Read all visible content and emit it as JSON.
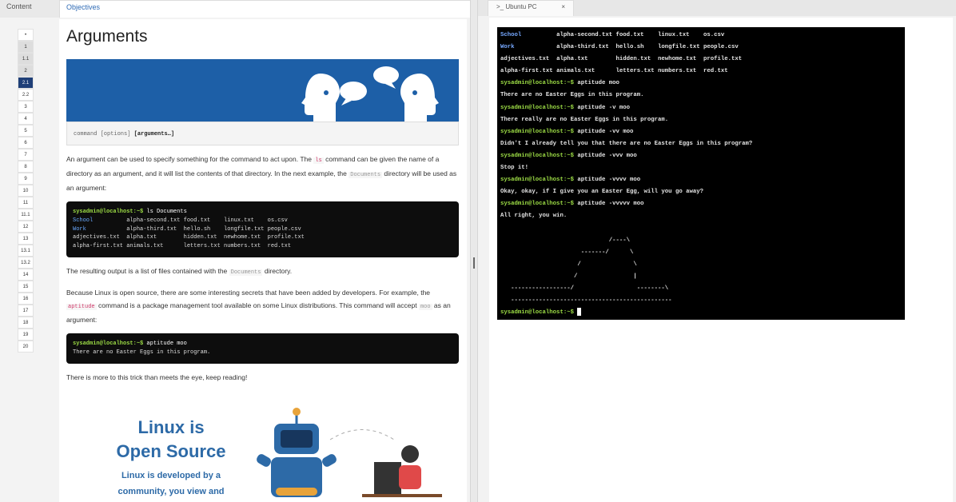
{
  "left_tabs": {
    "content": "Content",
    "objectives": "Objectives"
  },
  "nav": [
    "•",
    "1",
    "1.1",
    "2",
    "2.1",
    "2.2",
    "3",
    "4",
    "5",
    "6",
    "7",
    "8",
    "9",
    "10",
    "11",
    "11.1",
    "12",
    "13",
    "13.1",
    "13.2",
    "14",
    "15",
    "16",
    "17",
    "18",
    "19",
    "20"
  ],
  "doc": {
    "title": "Arguments",
    "syntax_prefix": "command [options] ",
    "syntax_bold": "[arguments…]",
    "p1a": "An argument can be used to specify something for the command to act upon. The ",
    "p1_ls": "ls",
    "p1b": " command can be given the name of a directory as an argument, and it will list the contents of that directory. In the next example, the ",
    "p1_doc": "Documents",
    "p1c": " directory will be used as an argument:",
    "code1_prompt": "sysadmin@localhost:~$",
    "code1_cmd": " ls Documents",
    "code1_rows": [
      {
        "a": "School",
        "b": "alpha-second.txt",
        "c": "food.txt",
        "d": "linux.txt",
        "e": "os.csv",
        "blue": true
      },
      {
        "a": "Work",
        "b": "alpha-third.txt",
        "c": "hello.sh",
        "d": "longfile.txt",
        "e": "people.csv",
        "blue": true
      },
      {
        "a": "adjectives.txt",
        "b": "alpha.txt",
        "c": "hidden.txt",
        "d": "newhome.txt",
        "e": "profile.txt",
        "blue": false
      },
      {
        "a": "alpha-first.txt",
        "b": "animals.txt",
        "c": "letters.txt",
        "d": "numbers.txt",
        "e": "red.txt",
        "blue": false
      }
    ],
    "p2a": "The resulting output is a list of files contained with the ",
    "p2_doc": "Documents",
    "p2b": " directory.",
    "p3a": "Because Linux is open source, there are some interesting secrets that have been added by developers. For example, the ",
    "p3_apt": "aptitude",
    "p3b": " command is a package management tool available on some Linux distributions. This command will accept ",
    "p3_moo": "moo",
    "p3c": " as an argument:",
    "code2_prompt": "sysadmin@localhost:~$",
    "code2_cmd": " aptitude moo",
    "code2_out": "There are no Easter Eggs in this program.",
    "p4": "There is more to this trick than meets the eye, keep reading!",
    "promo_l1": "Linux is",
    "promo_l2": "Open Source",
    "promo_l3": "Linux is developed by a",
    "promo_l4": "community, you view and"
  },
  "right_tab": {
    "title": "Ubuntu PC",
    "close": "×",
    "icon": ">_"
  },
  "terminal": {
    "ls_rows": [
      [
        "School",
        "alpha-second.txt",
        "food.txt",
        "linux.txt",
        "os.csv"
      ],
      [
        "Work",
        "alpha-third.txt",
        "hello.sh",
        "longfile.txt",
        "people.csv"
      ],
      [
        "adjectives.txt",
        "alpha.txt",
        "hidden.txt",
        "newhome.txt",
        "profile.txt"
      ],
      [
        "alpha-first.txt",
        "animals.txt",
        "letters.txt",
        "numbers.txt",
        "red.txt"
      ]
    ],
    "prompt": "sysadmin@localhost:~$",
    "session": [
      {
        "cmd": " aptitude moo",
        "out": "There are no Easter Eggs in this program."
      },
      {
        "cmd": " aptitude -v moo",
        "out": "There really are no Easter Eggs in this program."
      },
      {
        "cmd": " aptitude -vv moo",
        "out": "Didn't I already tell you that there are no Easter Eggs in this program?"
      },
      {
        "cmd": " aptitude -vvv moo",
        "out": "Stop it!"
      },
      {
        "cmd": " aptitude -vvvv moo",
        "out": "Okay, okay, if I give you an Easter Egg, will you go away?"
      },
      {
        "cmd": " aptitude -vvvvv moo",
        "out": "All right, you win."
      }
    ],
    "art": "                               /----\\\n                       -------/      \\\n                      /               \\\n                     /                |\n   -----------------/                  --------\\\n   ----------------------------------------------"
  },
  "colors": {
    "banner": "#1d5fa7",
    "prompt": "#9cdc45",
    "dir": "#76a8ff",
    "nav_selected": "#1f3f77"
  }
}
